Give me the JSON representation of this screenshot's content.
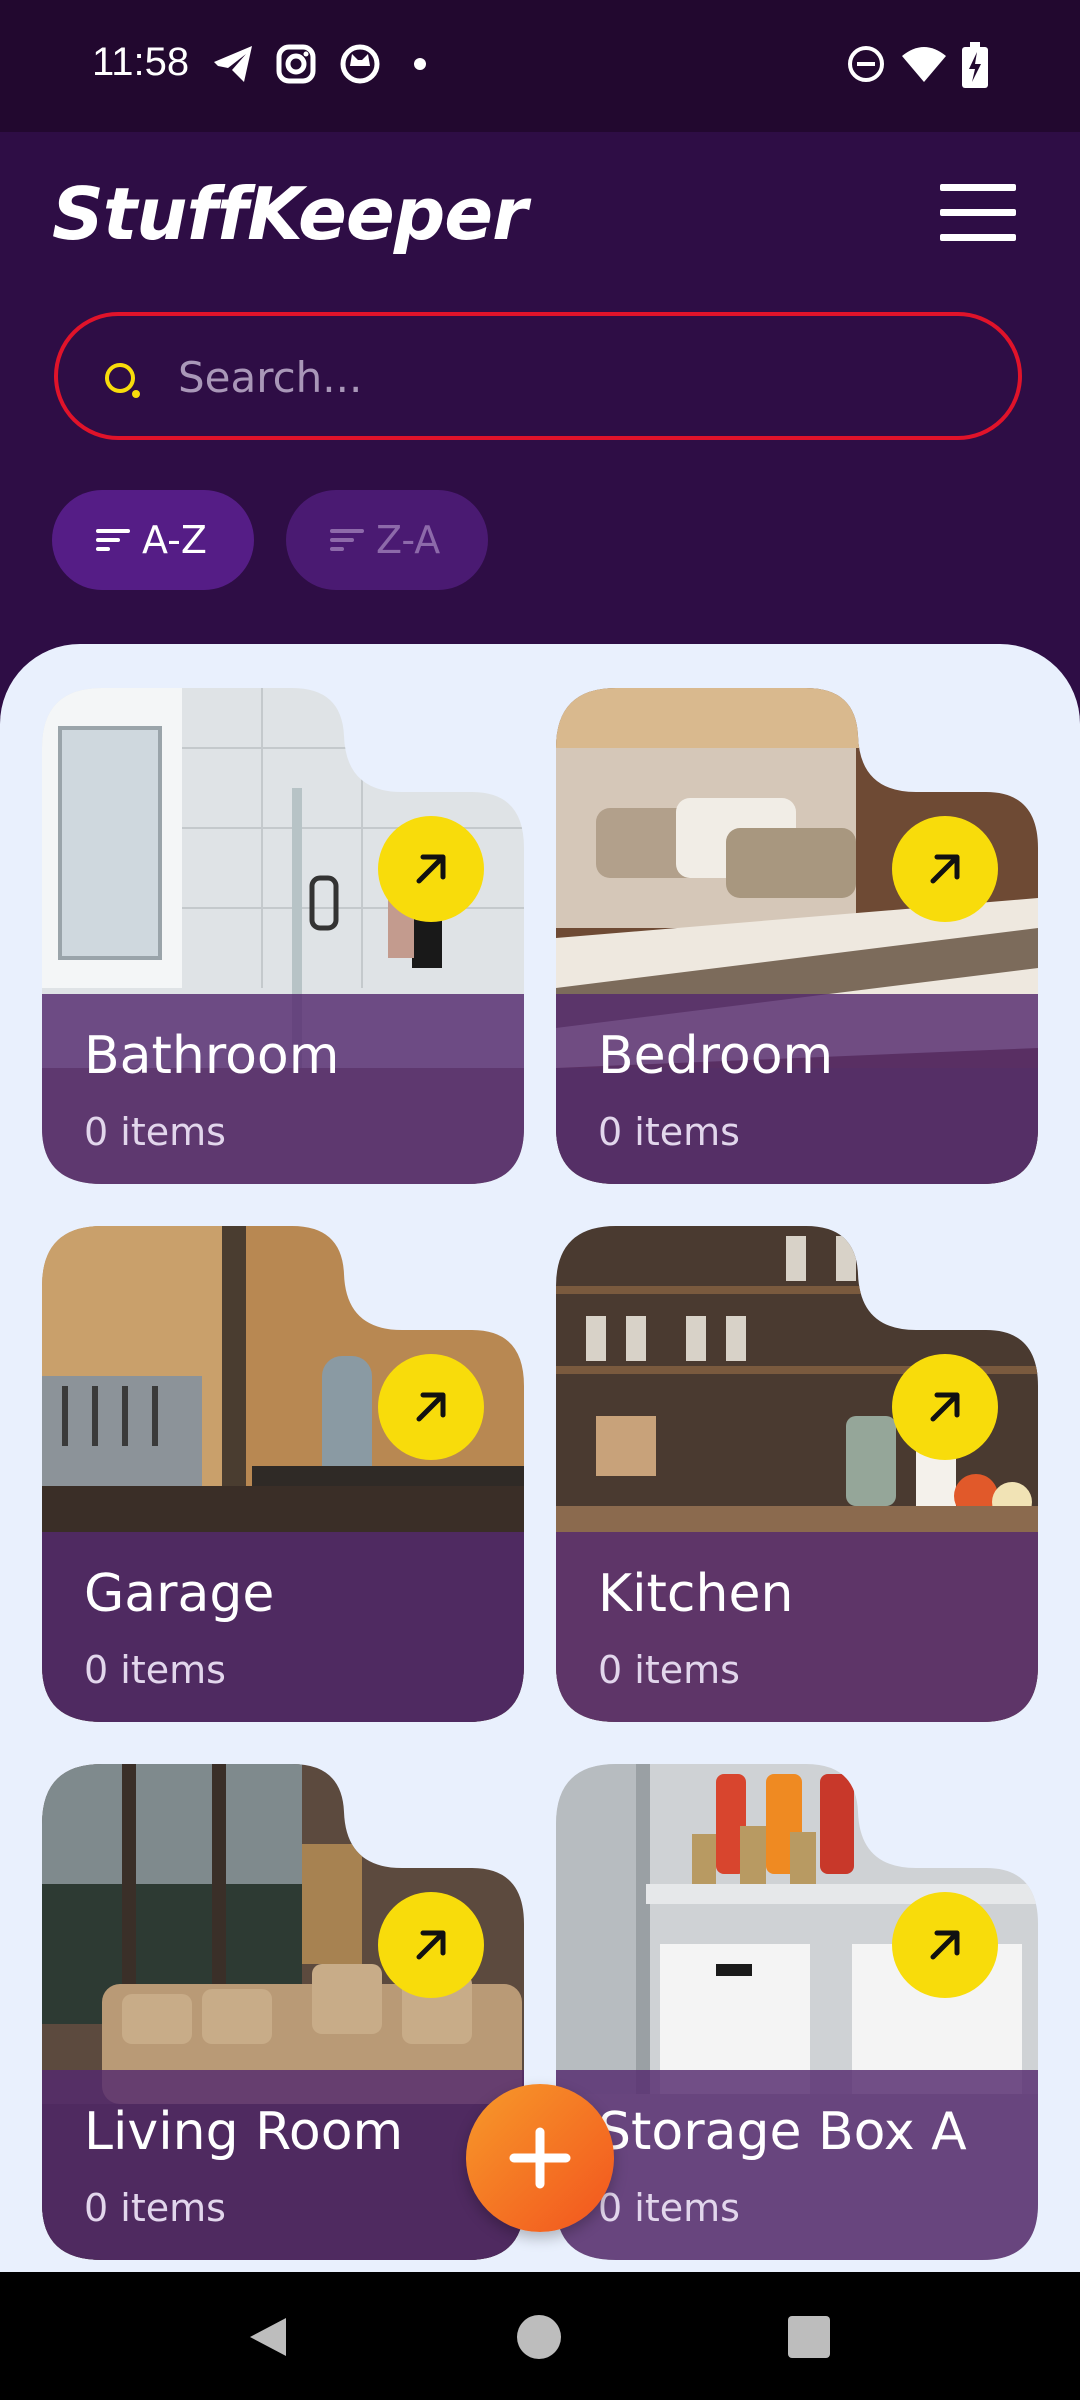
{
  "status_bar": {
    "time": "11:58",
    "left_icons": [
      "telegram-icon",
      "instagram-icon",
      "cat-app-icon",
      "dot-icon"
    ],
    "right_icons": [
      "do-not-disturb-icon",
      "wifi-icon",
      "battery-charging-icon"
    ]
  },
  "header": {
    "title": "StuffKeeper",
    "menu_icon": "hamburger-menu-icon"
  },
  "search": {
    "placeholder": "Search...",
    "value": "",
    "border_color": "#e0132a",
    "icon_color": "#f8dc0b"
  },
  "sort": {
    "az_label": "A-Z",
    "za_label": "Z-A",
    "active": "A-Z"
  },
  "rooms": [
    {
      "name": "Bathroom",
      "count": "0 items"
    },
    {
      "name": "Bedroom",
      "count": "0 items"
    },
    {
      "name": "Garage",
      "count": "0 items"
    },
    {
      "name": "Kitchen",
      "count": "0 items"
    },
    {
      "name": "Living Room",
      "count": "0 items"
    },
    {
      "name": "Storage Box A",
      "count": "0 items"
    }
  ],
  "fab": {
    "icon": "plus-icon",
    "color": "#f47a22"
  },
  "nav": {
    "icons": [
      "back-icon",
      "home-icon",
      "recents-icon"
    ]
  },
  "colors": {
    "header_bg": "#2e0d45",
    "content_bg": "#e9f0fd",
    "accent_yellow": "#f8dc0b",
    "chip_bg": "#551d86"
  }
}
